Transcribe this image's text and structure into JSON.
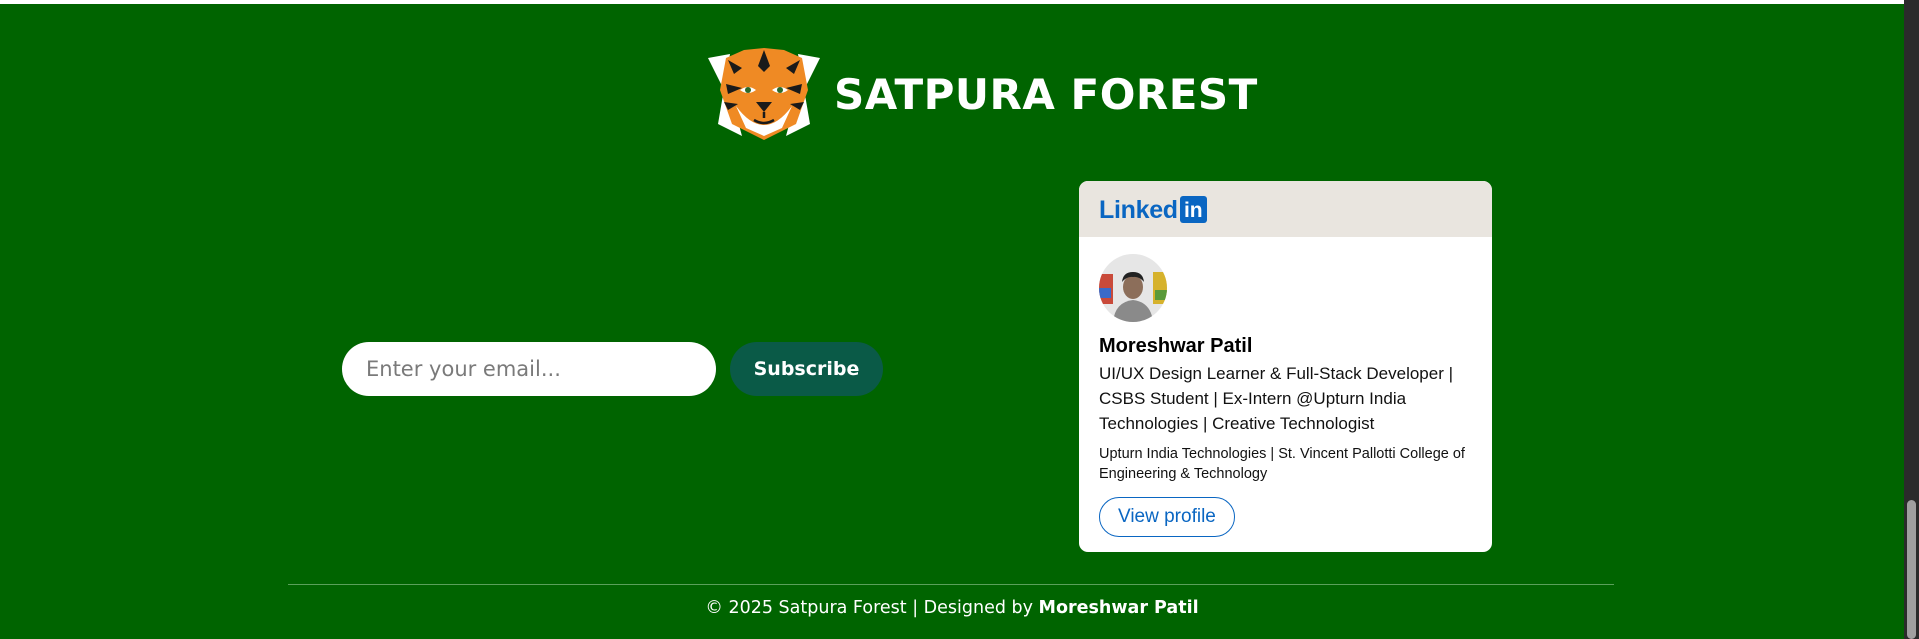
{
  "brand": {
    "name": "SATPURA FOREST",
    "logo_icon": "tiger-icon"
  },
  "newsletter": {
    "email_placeholder": "Enter your email...",
    "subscribe_label": "Subscribe"
  },
  "linkedin_card": {
    "logo_text": "Linked",
    "logo_badge": "in",
    "name": "Moreshwar Patil",
    "headline": "UI/UX Design Learner & Full-Stack Developer | CSBS Student | Ex-Intern @Upturn India Technologies | Creative Technologist",
    "company": "Upturn India Technologies | St. Vincent Pallotti College of Engineering & Technology",
    "view_profile_label": "View profile"
  },
  "footer": {
    "copyright_prefix": "© 2025 Satpura Forest | Designed by ",
    "designer": "Moreshwar Patil"
  },
  "colors": {
    "background": "#006400",
    "subscribe_button": "#0a5a47",
    "linkedin_blue": "#0a66c2",
    "tiger_orange": "#ef8a24"
  }
}
